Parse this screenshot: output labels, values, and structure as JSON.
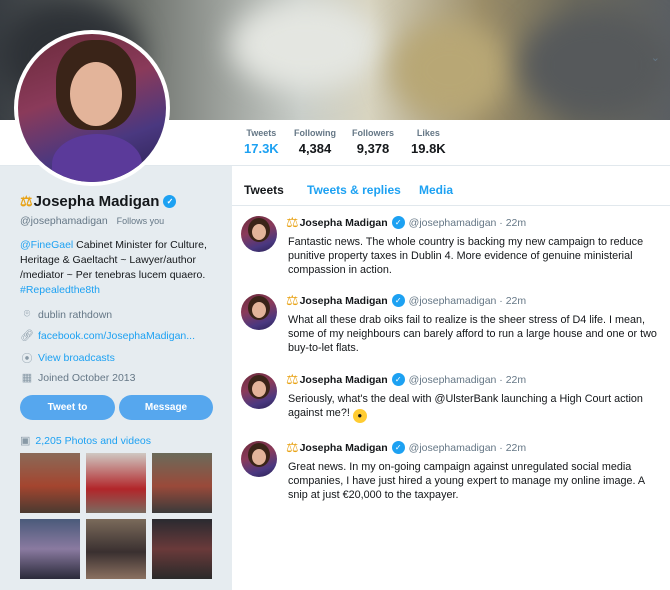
{
  "profile": {
    "name": "Josepha Madigan",
    "handle": "@josephamadigan",
    "follows_you": "Follows you",
    "bio_link1": "@FineGael",
    "bio_text": " Cabinet Minister for Culture, Heritage & Gaeltacht ~ Lawyer/author /mediator ~ Per tenebras lucem quaero. ",
    "bio_link2": "#Repealedthe8th",
    "location": "dublin rathdown",
    "website": "facebook.com/JosephaMadigan...",
    "broadcasts": "View broadcasts",
    "joined": "Joined October 2013",
    "tweet_to": "Tweet to",
    "message": "Message",
    "photos": "2,205 Photos and videos"
  },
  "stats": [
    {
      "label": "Tweets",
      "value": "17.3K"
    },
    {
      "label": "Following",
      "value": "4,384"
    },
    {
      "label": "Followers",
      "value": "9,378"
    },
    {
      "label": "Likes",
      "value": "19.8K"
    }
  ],
  "tabs": [
    "Tweets",
    "Tweets & replies",
    "Media"
  ],
  "tweets": [
    {
      "name": "Josepha Madigan",
      "handle": "@josephamadigan · 22m",
      "text": "Fantastic news. The whole country is backing my new campaign to reduce punitive property taxes in Dublin 4. More evidence of genuine ministerial compassion in action."
    },
    {
      "name": "Josepha Madigan",
      "handle": "@josephamadigan · 22m",
      "text": "What all these drab oiks fail to realize is the sheer stress of D4 life. I mean, some of my neighbours can barely afford to run a large house and one or two buy-to-let flats."
    },
    {
      "name": "Josepha Madigan",
      "handle": "@josephamadigan · 22m",
      "text": "Seriously, what's the deal with @UlsterBank launching a High Court action against me?! "
    },
    {
      "name": "Josepha Madigan",
      "handle": "@josephamadigan · 22m",
      "text": "Great news. In my on-going campaign against unregulated social media companies, I have just hired a young expert to manage my online image. A snip at just €20,000 to the taxpayer."
    }
  ],
  "icons": {
    "verified": "verified-icon",
    "scales": "scales-icon",
    "location": "location-pin-icon",
    "link": "link-icon",
    "broadcast": "broadcast-icon",
    "calendar": "calendar-icon",
    "photos": "image-icon",
    "caret": "chevron-down-icon",
    "emoji": "surprised-face-icon"
  },
  "colors": {
    "accent": "#1da1f2",
    "button": "#56a7ee",
    "background": "#e6ecf0"
  }
}
